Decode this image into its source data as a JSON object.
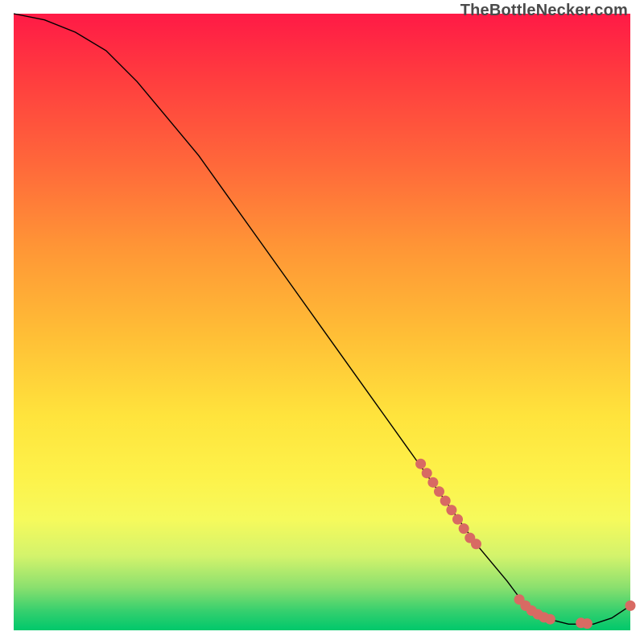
{
  "watermark": "TheBottleNecker.com",
  "chart_data": {
    "type": "line",
    "title": "",
    "xlabel": "",
    "ylabel": "",
    "xlim": [
      0,
      100
    ],
    "ylim": [
      0,
      100
    ],
    "series": [
      {
        "name": "bottleneck-curve",
        "x": [
          0,
          5,
          10,
          15,
          20,
          25,
          30,
          35,
          40,
          45,
          50,
          55,
          60,
          65,
          70,
          75,
          80,
          83,
          86,
          90,
          94,
          97,
          100
        ],
        "y": [
          100,
          99,
          97,
          94,
          89,
          83,
          77,
          70,
          63,
          56,
          49,
          42,
          35,
          28,
          21,
          14,
          8,
          4,
          2,
          1,
          1,
          2,
          4
        ]
      }
    ],
    "scatter": [
      {
        "name": "highlighted-points",
        "x": [
          66,
          67,
          68,
          69,
          70,
          71,
          72,
          73,
          74,
          75,
          82,
          83,
          84,
          85,
          86,
          87,
          92,
          93,
          100
        ],
        "y": [
          27,
          25.5,
          24,
          22.5,
          21,
          19.5,
          18,
          16.5,
          15,
          14,
          5,
          4,
          3.2,
          2.6,
          2.1,
          1.8,
          1.2,
          1.1,
          4
        ]
      }
    ]
  }
}
